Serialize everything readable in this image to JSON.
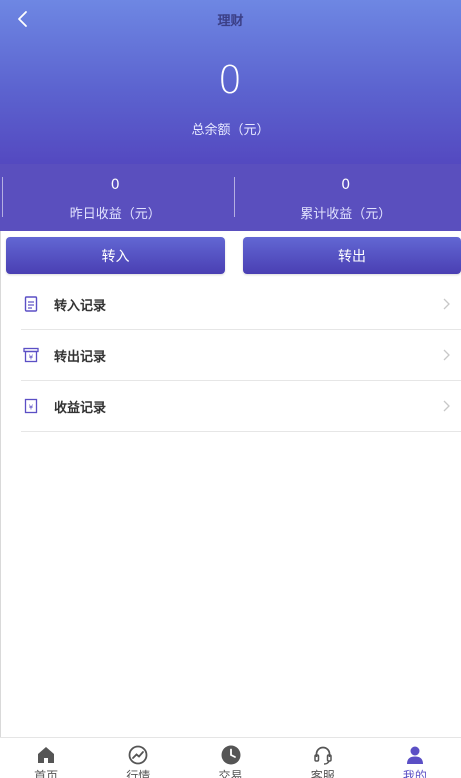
{
  "header": {
    "title": "理财",
    "back_icon": "chevron-left-icon"
  },
  "balance": {
    "value": "0",
    "label": "总余额（元）"
  },
  "stats": {
    "yesterday": {
      "value": "0",
      "label": "昨日收益（元）"
    },
    "total": {
      "value": "0",
      "label": "累计收益（元）"
    }
  },
  "actions": {
    "transfer_in": "转入",
    "transfer_out": "转出"
  },
  "menu": {
    "items": [
      {
        "label": "转入记录",
        "icon": "document-list-icon"
      },
      {
        "label": "转出记录",
        "icon": "outbox-icon"
      },
      {
        "label": "收益记录",
        "icon": "yuan-receipt-icon"
      }
    ]
  },
  "tabbar": {
    "items": [
      {
        "label": "首页",
        "icon": "home-icon"
      },
      {
        "label": "行情",
        "icon": "trend-icon"
      },
      {
        "label": "交易",
        "icon": "clock-icon"
      },
      {
        "label": "客服",
        "icon": "headset-icon"
      },
      {
        "label": "我的",
        "icon": "user-icon",
        "active": true
      }
    ]
  },
  "colors": {
    "accent": "#5b4fc5",
    "hero_top": "#6e87e3",
    "hero_bottom": "#5449c0"
  }
}
